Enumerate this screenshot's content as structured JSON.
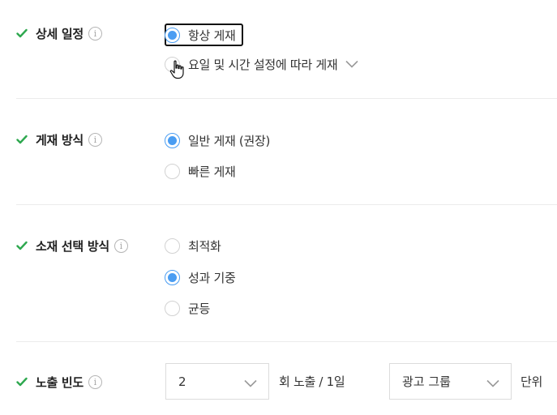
{
  "sections": {
    "detail_schedule": {
      "label": "상세 일정",
      "options": [
        "항상 게재",
        "요일 및 시간 설정에 따라 게재"
      ]
    },
    "delivery_method": {
      "label": "게재 방식",
      "options": [
        "일반 게재 (권장)",
        "빠른 게재"
      ]
    },
    "creative_selection": {
      "label": "소재 선택 방식",
      "options": [
        "최적화",
        "성과 기중",
        "균등"
      ]
    },
    "frequency": {
      "label": "노출 빈도",
      "count_value": "2",
      "middle_text": "회 노출 / 1일",
      "unit_value": "광고 그룹",
      "suffix_text": "단위"
    }
  },
  "icons": {
    "check": "checkmark-icon",
    "info": "info-icon",
    "chevron": "chevron-down-icon",
    "cursor": "hand-pointer-icon"
  },
  "info_glyph": "i",
  "colors": {
    "check_green": "#2ea84f",
    "radio_blue": "#4a9df2",
    "divider": "#ececec",
    "chevron_gray": "#9a9a9a"
  }
}
